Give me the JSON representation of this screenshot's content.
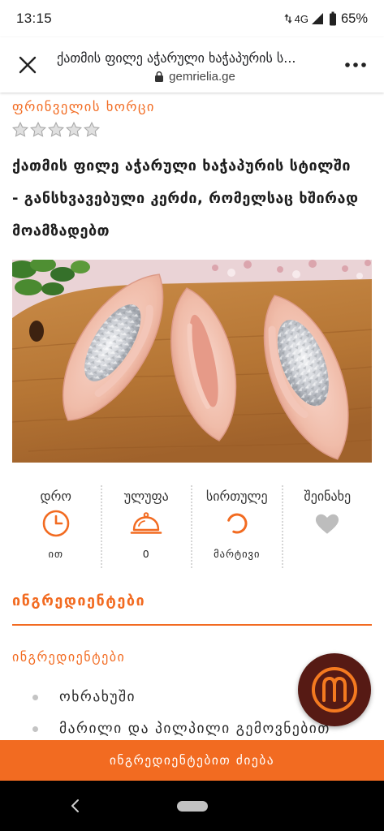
{
  "status_bar": {
    "time": "13:15",
    "network": "4G",
    "battery": "65%",
    "icons": [
      "data-arrows-icon",
      "signal-icon",
      "battery-icon"
    ]
  },
  "browser": {
    "title": "ქათმის ფილე აჭარული ხაჭაპურის ს...",
    "domain": "gemrielia.ge",
    "icons": {
      "close": "close-icon",
      "lock": "lock-icon",
      "menu": "more-options-icon"
    }
  },
  "article": {
    "category": "ფრინველის ხორცი",
    "rating": {
      "filled": 0,
      "max": 5
    },
    "title": "ქათმის ფილე აჭარული ხაჭაპურის სტილში - განსხვავებული კერძი, რომელსაც ხშირად მოამზადებთ",
    "info": [
      {
        "label": "დრო",
        "icon": "clock-icon",
        "value": "ით"
      },
      {
        "label": "ულუფა",
        "icon": "serving-dish-icon",
        "value": "0"
      },
      {
        "label": "სირთულე",
        "icon": "difficulty-icon",
        "value": "მარტივი"
      },
      {
        "label": "შეინახე",
        "icon": "heart-icon"
      }
    ]
  },
  "ingredients": {
    "heading": "ინგრედიენტები",
    "subheading": "ინგრედიენტები",
    "items": [
      "ოხრახუში",
      "მარილი და პილპილი გემოვნებით"
    ]
  },
  "fab": {
    "icon": "chef-logo-icon"
  },
  "bottom_bar": {
    "label": "ინგრედიენტებით ძიება"
  },
  "nav_bar": {
    "icons": [
      "back-icon",
      "home-pill-icon"
    ]
  },
  "colors": {
    "accent": "#f26b21",
    "text": "#222222",
    "fab": "#561a14",
    "muted_icon": "#bdbdbd"
  }
}
